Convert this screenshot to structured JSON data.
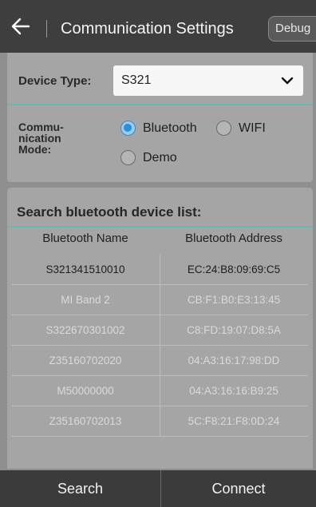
{
  "header": {
    "title": "Communication Settings",
    "debug_label": "Debug",
    "back_icon": "back-arrow-icon"
  },
  "settings": {
    "device_type_label": "Device Type:",
    "device_type_value": "S321",
    "mode_label": "Commu-\nnication\nMode:",
    "modes": [
      {
        "label": "Bluetooth",
        "selected": true
      },
      {
        "label": "WIFI",
        "selected": false
      },
      {
        "label": "Demo",
        "selected": false
      }
    ]
  },
  "device_list": {
    "title": "Search bluetooth device list:",
    "columns": [
      "Bluetooth Name",
      "Bluetooth Address"
    ],
    "rows": [
      {
        "name": "S321341510010",
        "address": "EC:24:B8:09:69:C5",
        "highlighted": true
      },
      {
        "name": "MI Band 2",
        "address": "CB:F1:B0:E3:13:45",
        "highlighted": false
      },
      {
        "name": "S322670301002",
        "address": "C8:FD:19:07:D8:5A",
        "highlighted": false
      },
      {
        "name": "Z35160702020",
        "address": "04:A3:16:17:98:DD",
        "highlighted": false
      },
      {
        "name": "M50000000",
        "address": "04:A3:16:16:B9:25",
        "highlighted": false
      },
      {
        "name": "Z35160702013",
        "address": "5C:F8:21:F8:0D:24",
        "highlighted": false
      }
    ]
  },
  "footer": {
    "search_label": "Search",
    "connect_label": "Connect"
  },
  "colors": {
    "accent": "#2a8fd9",
    "divider": "#68b7b4",
    "bar": "#3e3e3e"
  }
}
